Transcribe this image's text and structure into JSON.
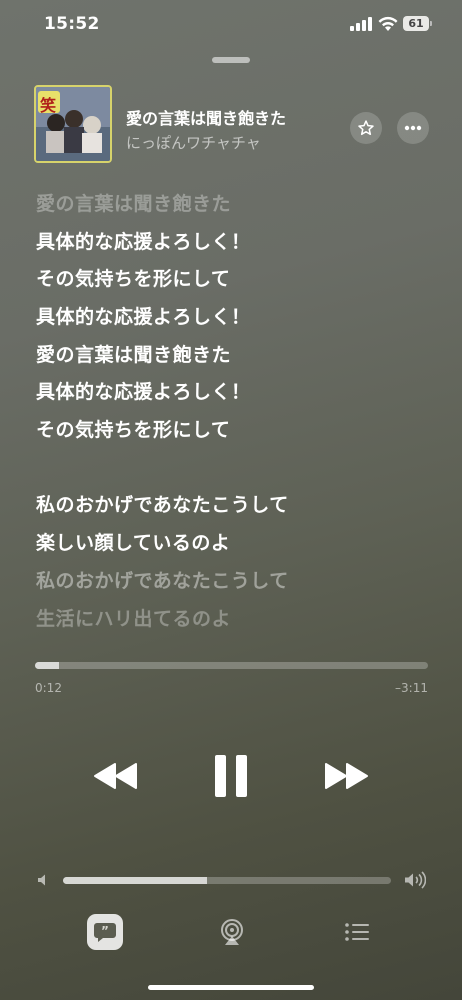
{
  "status_bar": {
    "time": "15:52",
    "battery": "61",
    "icons": [
      "cellular-signal-icon",
      "wifi-icon",
      "battery-icon"
    ]
  },
  "now_playing": {
    "title": "愛の言葉は聞き飽きた",
    "artist": "にっぽんワチャチャ",
    "artwork_text": "笑"
  },
  "lyrics": [
    {
      "text": "愛の言葉は聞き飽きた",
      "state": "past"
    },
    {
      "text": "具体的な応援よろしく！",
      "state": "active"
    },
    {
      "text": "その気持ちを形にして",
      "state": "active"
    },
    {
      "text": "具体的な応援よろしく！",
      "state": "active"
    },
    {
      "text": "愛の言葉は聞き飽きた",
      "state": "active"
    },
    {
      "text": "具体的な応援よろしく！",
      "state": "active"
    },
    {
      "text": "その気持ちを形にして",
      "state": "active"
    },
    {
      "text": "私のおかげであなたこうして",
      "state": "upcoming"
    },
    {
      "text": "楽しい顔しているのよ",
      "state": "upcoming"
    },
    {
      "text": "私のおかげであなたこうして",
      "state": "upcoming-dim"
    },
    {
      "text": "生活にハリ出てるのよ",
      "state": "upcoming-faint"
    }
  ],
  "playback": {
    "elapsed": "0:12",
    "remaining": "–3:11",
    "progress_fraction": 0.06,
    "volume_fraction": 0.44,
    "state": "playing"
  },
  "controls": {
    "icons": [
      "rewind-icon",
      "pause-icon",
      "fast-forward-icon",
      "star-icon",
      "ellipsis-icon",
      "lyrics-quote-icon",
      "airplay-icon",
      "queue-list-icon",
      "speaker-low-icon",
      "speaker-high-icon"
    ]
  }
}
